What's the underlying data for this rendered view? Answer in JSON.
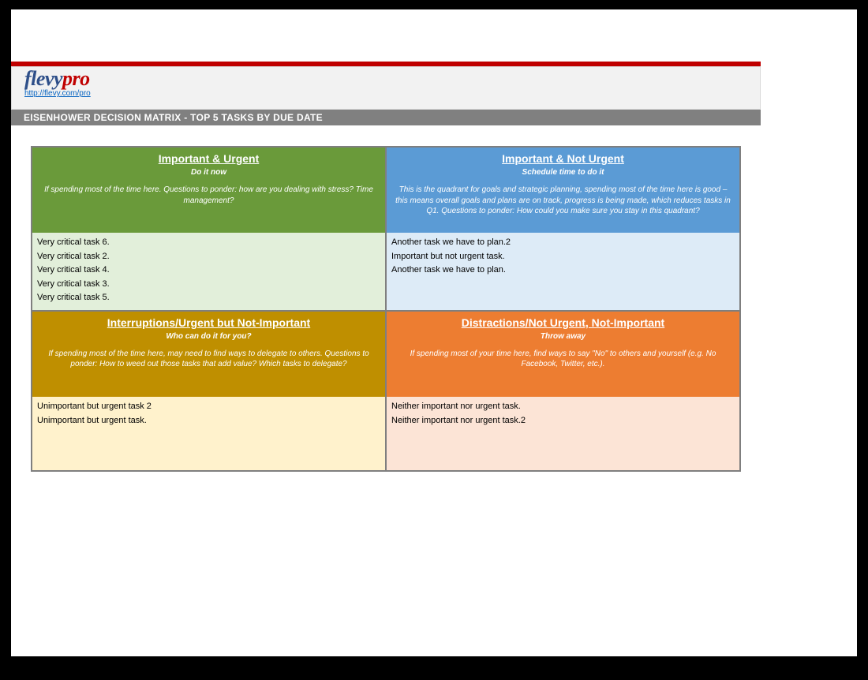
{
  "header": {
    "logo_flevy": "flevy",
    "logo_pro": "pro",
    "url": "http://flevy.com/pro"
  },
  "title_bar": "EISENHOWER DECISION MATRIX - TOP 5 TASKS BY DUE DATE",
  "quadrants": {
    "q1": {
      "title": "Important & Urgent",
      "subtitle": "Do it now",
      "desc": "If spending most of the time here. Questions to ponder: how are you dealing with stress? Time management?",
      "tasks": [
        "Very critical task 6.",
        "Very critical task 2.",
        "Very critical task 4.",
        "Very critical task 3.",
        "Very critical task 5."
      ]
    },
    "q2": {
      "title": "Important & Not Urgent",
      "subtitle": "Schedule time to do it",
      "desc": "This is the quadrant for goals and strategic planning, spending most of the time here is good – this means overall goals and plans are on track, progress is being made, which reduces tasks in Q1. Questions to ponder: How could you make sure you stay in this quadrant?",
      "tasks": [
        "Another task we have to plan.2",
        "Important but not urgent task.",
        "Another task we have to plan."
      ]
    },
    "q3": {
      "title": "Interruptions/Urgent but Not-Important",
      "subtitle": "Who can do it for you?",
      "desc": "If spending most of the time here, may need to find ways to delegate to others. Questions to ponder: How to weed out those tasks that add value? Which tasks to delegate?",
      "tasks": [
        "Unimportant but urgent task 2",
        "Unimportant but urgent task."
      ]
    },
    "q4": {
      "title": "Distractions/Not Urgent, Not-Important",
      "subtitle": "Throw away",
      "desc": "If spending most of your time here, find ways to say \"No\" to others and yourself (e.g. No Facebook, Twitter, etc.).",
      "tasks": [
        "Neither important nor urgent task.",
        "Neither important nor urgent task.2"
      ]
    }
  }
}
